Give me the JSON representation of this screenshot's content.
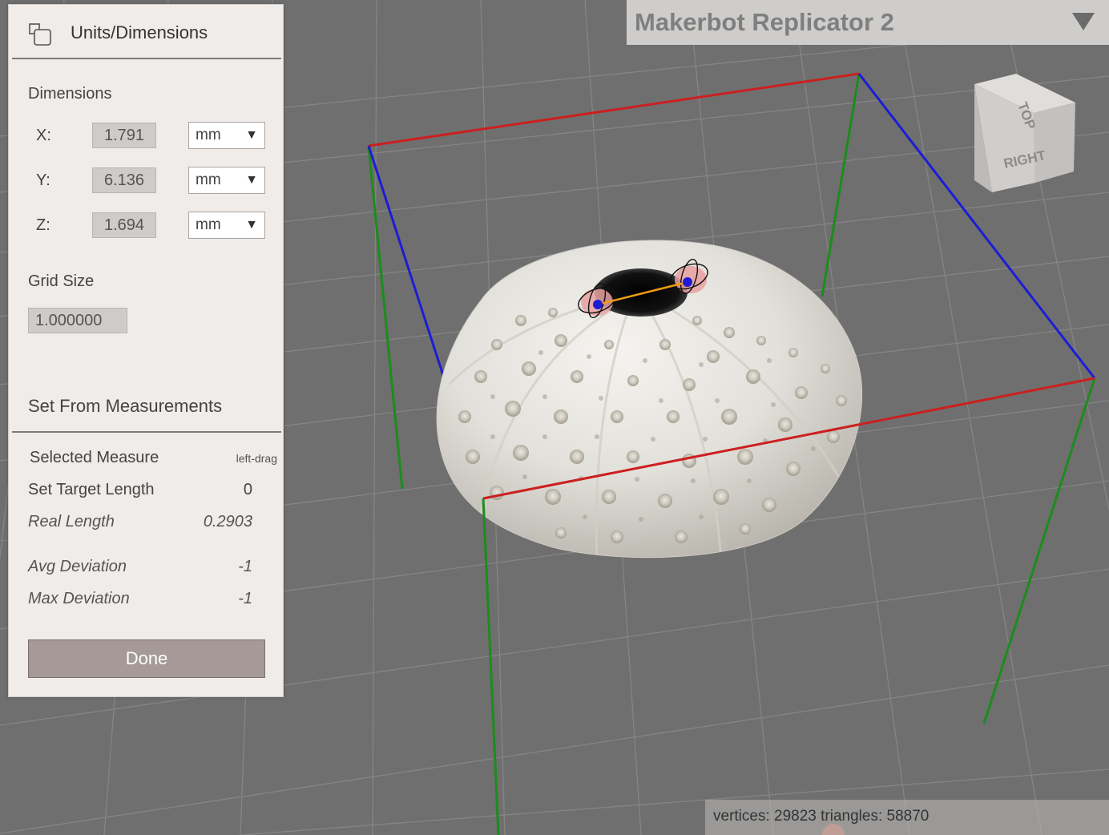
{
  "panel": {
    "title": "Units/Dimensions",
    "dimensions_heading": "Dimensions",
    "dimensions": [
      {
        "axis": "X:",
        "value": "1.791",
        "unit": "mm"
      },
      {
        "axis": "Y:",
        "value": "6.136",
        "unit": "mm"
      },
      {
        "axis": "Z:",
        "value": "1.694",
        "unit": "mm"
      }
    ],
    "grid_size_heading": "Grid Size",
    "grid_size_value": "1.000000",
    "set_from_measurements_heading": "Set From Measurements",
    "selected_measure_label": "Selected Measure",
    "selected_measure_hint": "left-drag",
    "set_target_length_label": "Set Target Length",
    "set_target_length_value": "0",
    "real_length_label": "Real Length",
    "real_length_value": "0.2903",
    "avg_deviation_label": "Avg Deviation",
    "avg_deviation_value": "-1",
    "max_deviation_label": "Max Deviation",
    "max_deviation_value": "-1",
    "done_label": "Done"
  },
  "printer": {
    "selected": "Makerbot Replicator 2"
  },
  "view_cube": {
    "top_label": "TOP",
    "right_label": "RIGHT"
  },
  "stats": {
    "text": "vertices: 29823 triangles: 58870"
  },
  "colors": {
    "panel_bg": "#efecea",
    "viewport_bg": "#6f6f6f",
    "grid_line": "#858585",
    "bbox_red": "#cc1f1f",
    "bbox_blue": "#1c1cd6",
    "bbox_green": "#1c8c1c",
    "measure_line": "#f39c12",
    "done_button": "#a59a98"
  }
}
